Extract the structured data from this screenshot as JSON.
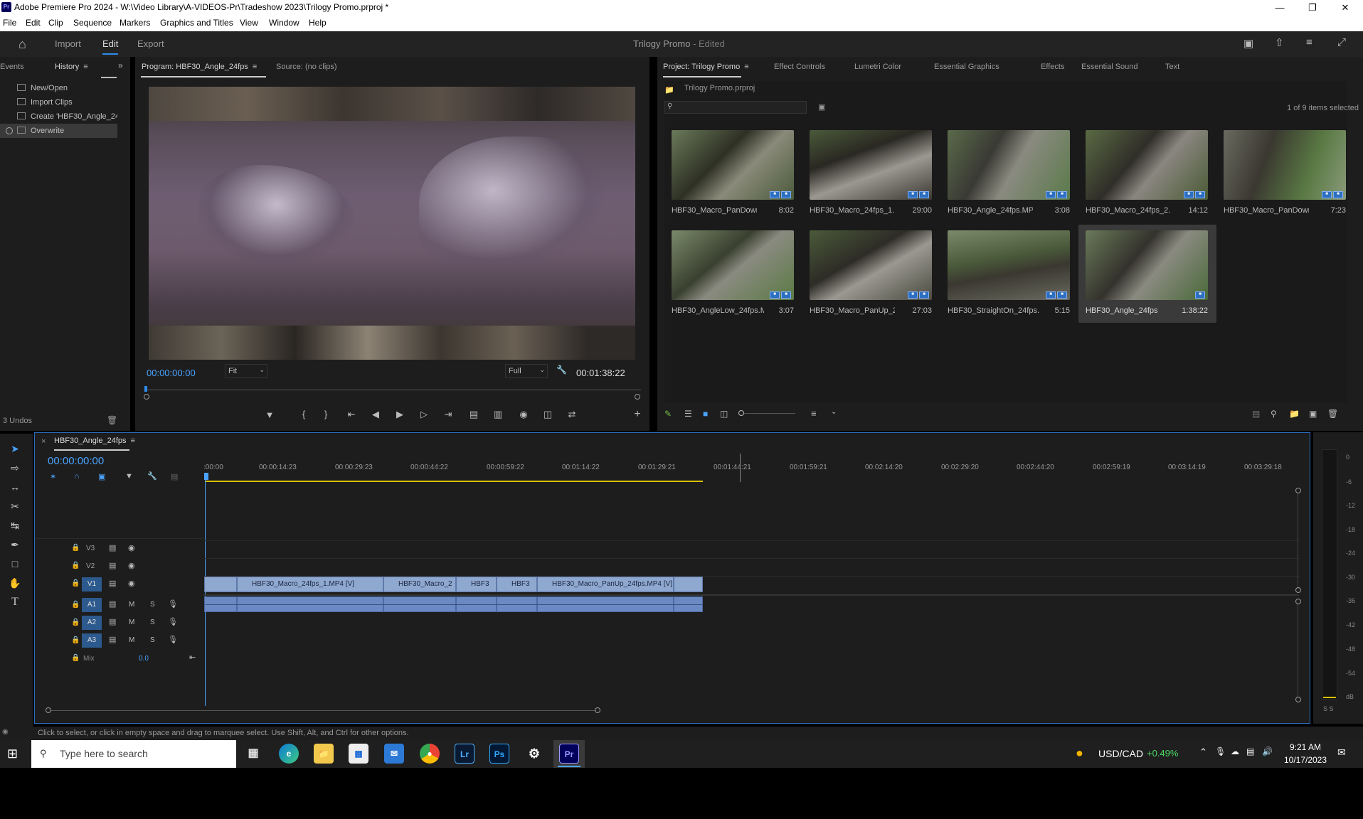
{
  "window": {
    "title": "Adobe Premiere Pro 2024 - W:\\Video Library\\A-VIDEOS-Pr\\Tradeshow 2023\\Trilogy Promo.prproj *",
    "app_badge": "Pr"
  },
  "menu": [
    "File",
    "Edit",
    "Clip",
    "Sequence",
    "Markers",
    "Graphics and Titles",
    "View",
    "Window",
    "Help"
  ],
  "workspace": {
    "tabs": [
      "Import",
      "Edit",
      "Export"
    ],
    "active_tab": "Edit",
    "project_name": "Trilogy Promo",
    "edited": "- Edited"
  },
  "history_panel": {
    "tabs": [
      "Events",
      "History"
    ],
    "items": [
      "New/Open",
      "Import Clips",
      "Create 'HBF30_Angle_24",
      "Overwrite"
    ],
    "undos": "3 Undos"
  },
  "program_monitor": {
    "tab": "Program: HBF30_Angle_24fps",
    "source_tab": "Source: (no clips)",
    "timecode": "00:00:00:00",
    "fit": "Fit",
    "resolution": "Full",
    "duration": "00:01:38:22"
  },
  "project_panel": {
    "tabs": [
      "Project: Trilogy Promo",
      "Effect Controls",
      "Lumetri Color",
      "Essential Graphics",
      "Effects",
      "Essential Sound",
      "Text"
    ],
    "file": "Trilogy Promo.prproj",
    "search_placeholder": "",
    "selection": "1 of 9 items selected",
    "items": [
      {
        "name": "HBF30_Macro_PanDown_...",
        "dur": "8:02"
      },
      {
        "name": "HBF30_Macro_24fps_1.M...",
        "dur": "29:00"
      },
      {
        "name": "HBF30_Angle_24fps.MP4",
        "dur": "3:08"
      },
      {
        "name": "HBF30_Macro_24fps_2.M...",
        "dur": "14:12"
      },
      {
        "name": "HBF30_Macro_PanDown_...",
        "dur": "7:23"
      },
      {
        "name": "HBF30_AngleLow_24fps.MP4",
        "dur": "3:07"
      },
      {
        "name": "HBF30_Macro_PanUp_24...",
        "dur": "27:03"
      },
      {
        "name": "HBF30_StraightOn_24fps...",
        "dur": "5:15"
      },
      {
        "name": "HBF30_Angle_24fps",
        "dur": "1:38:22"
      }
    ]
  },
  "timeline": {
    "sequence": "HBF30_Angle_24fps",
    "timecode": "00:00:00:00",
    "ruler": [
      ":00:00",
      "00:00:14:23",
      "00:00:29:23",
      "00:00:44:22",
      "00:00:59:22",
      "00:01:14:22",
      "00:01:29:21",
      "00:01:44:21",
      "00:01:59:21",
      "00:02:14:20",
      "00:02:29:20",
      "00:02:44:20",
      "00:02:59:19",
      "00:03:14:19",
      "00:03:29:18"
    ],
    "video_tracks": [
      "V3",
      "V2",
      "V1"
    ],
    "audio_tracks": [
      "A1",
      "A2",
      "A3"
    ],
    "mix_label": "Mix",
    "mix_value": "0.0",
    "clips": [
      "HBF30_Macro_24fps_1.MP4 [V]",
      "HBF30_Macro_2",
      "HBF3",
      "HBF3",
      "HBF30_Macro_PanUp_24fps.MP4 [V]",
      ""
    ]
  },
  "meter": {
    "ticks": [
      "0",
      "-6",
      "-12",
      "-18",
      "-24",
      "-30",
      "-36",
      "-42",
      "-48",
      "-54",
      "dB"
    ],
    "solo": "S S"
  },
  "status_bar": "Click to select, or click in empty space and drag to marquee select. Use Shift, Alt, and Ctrl for other options.",
  "taskbar": {
    "search_placeholder": "Type here to search",
    "ticker": "USD/CAD",
    "ticker_change": "+0.49%",
    "time": "9:21 AM",
    "date": "10/17/2023",
    "apps": [
      "Lr",
      "Ps",
      "Pr"
    ]
  }
}
